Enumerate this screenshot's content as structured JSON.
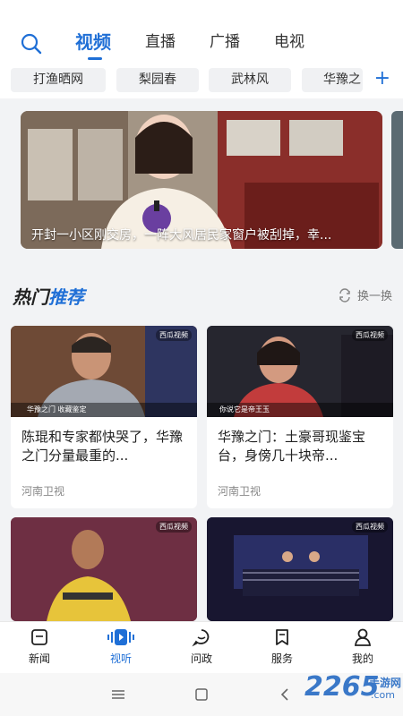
{
  "tabs": [
    "视频",
    "直播",
    "广播",
    "电视"
  ],
  "chips": [
    "打渔晒网",
    "梨园春",
    "武林风",
    "华豫之"
  ],
  "banner": {
    "caption": "开封一小区刚交房，一阵大风居民家窗户被刮掉，幸..."
  },
  "hot": {
    "title_a": "热门",
    "title_b": "推荐",
    "refresh_label": "换一换"
  },
  "cards": [
    {
      "title": "陈琨和专家都快哭了，华豫之门分量最重的...",
      "source": "河南卫视",
      "subtitle": "华豫之门 收藏鉴定",
      "watermark": "西瓜视频"
    },
    {
      "title": "华豫之门：土豪哥现鉴宝台，身傍几十块帝...",
      "source": "河南卫视",
      "subtitle": "你说它是帝王玉",
      "watermark": "西瓜视频"
    },
    {
      "title": "",
      "source": "",
      "subtitle": "",
      "watermark": "西瓜视频"
    },
    {
      "title": "",
      "source": "",
      "subtitle": "",
      "watermark": "西瓜视频"
    }
  ],
  "bottom_nav": [
    "新闻",
    "视听",
    "问政",
    "服务",
    "我的"
  ],
  "watermark_brand": {
    "main": "2265",
    "sub": "手游网",
    "domain": ".com"
  },
  "colors": {
    "accent": "#1f6fd6"
  }
}
